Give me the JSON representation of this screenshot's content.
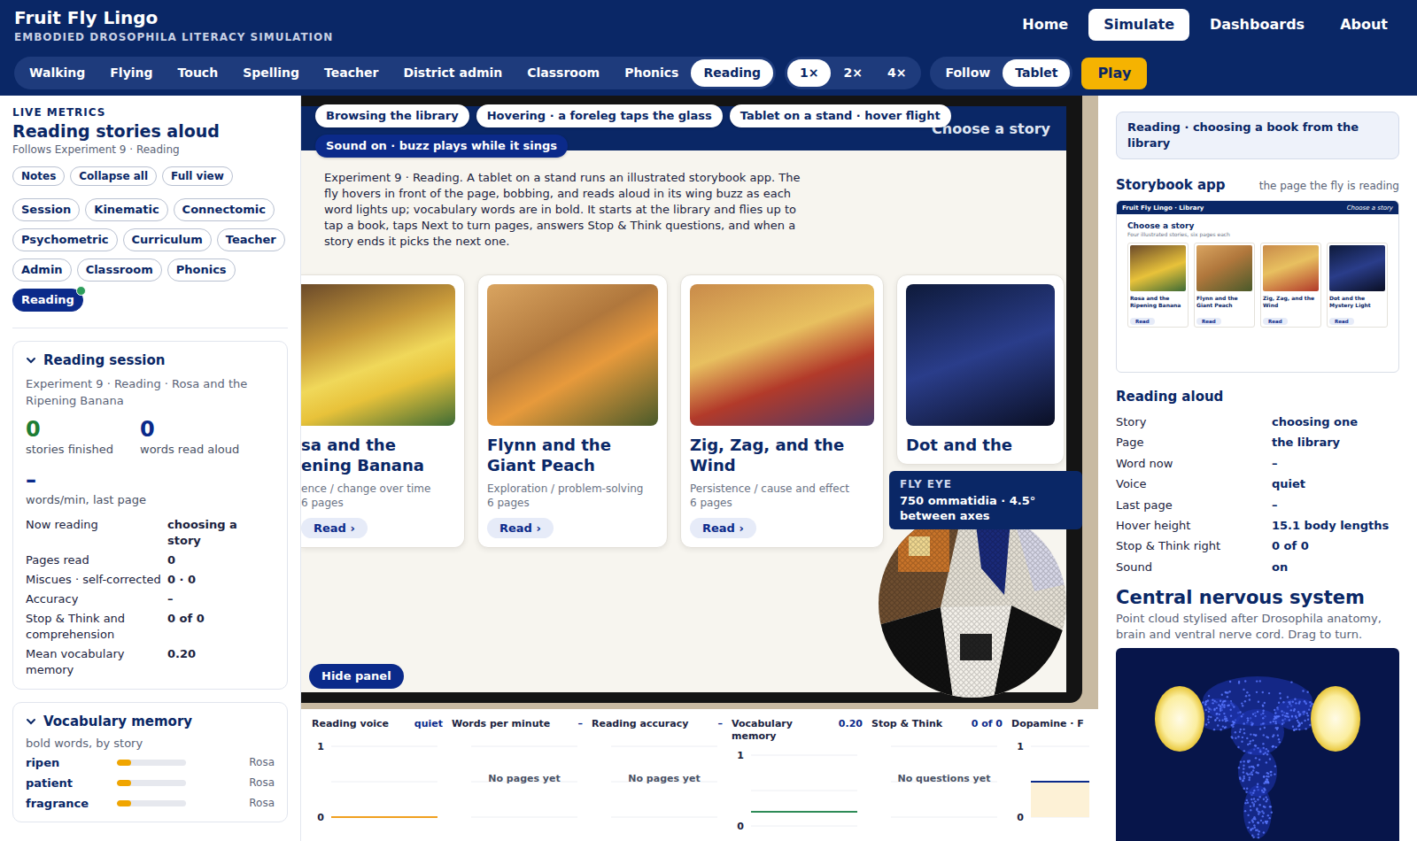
{
  "app": {
    "title": "Fruit Fly Lingo",
    "subtitle": "EMBODIED DROSOPHILA LITERACY SIMULATION"
  },
  "nav": [
    {
      "label": "Home",
      "selected": false
    },
    {
      "label": "Simulate",
      "selected": true
    },
    {
      "label": "Dashboards",
      "selected": false
    },
    {
      "label": "About",
      "selected": false
    }
  ],
  "modes": [
    {
      "label": "Walking",
      "selected": false
    },
    {
      "label": "Flying",
      "selected": false
    },
    {
      "label": "Touch",
      "selected": false
    },
    {
      "label": "Spelling",
      "selected": false
    },
    {
      "label": "Teacher",
      "selected": false
    },
    {
      "label": "District admin",
      "selected": false
    },
    {
      "label": "Classroom",
      "selected": false
    },
    {
      "label": "Phonics",
      "selected": false
    },
    {
      "label": "Reading",
      "selected": true
    }
  ],
  "speeds": [
    {
      "label": "1×",
      "selected": true
    },
    {
      "label": "2×",
      "selected": false
    },
    {
      "label": "4×",
      "selected": false
    }
  ],
  "camera": [
    {
      "label": "Follow",
      "selected": false
    },
    {
      "label": "Tablet",
      "selected": true
    }
  ],
  "play_button": "Play",
  "metrics_panel": {
    "eyebrow": "LIVE METRICS",
    "title": "Reading stories aloud",
    "subtitle": "Follows Experiment 9 · Reading",
    "actions": [
      "Notes",
      "Collapse all",
      "Full view"
    ],
    "filters": [
      {
        "label": "Session",
        "selected": false
      },
      {
        "label": "Kinematic",
        "selected": false
      },
      {
        "label": "Connectomic",
        "selected": false
      },
      {
        "label": "Psychometric",
        "selected": false
      },
      {
        "label": "Curriculum",
        "selected": false
      },
      {
        "label": "Teacher",
        "selected": false
      },
      {
        "label": "Admin",
        "selected": false
      },
      {
        "label": "Classroom",
        "selected": false
      },
      {
        "label": "Phonics",
        "selected": false
      },
      {
        "label": "Reading",
        "selected": true
      }
    ],
    "session_card": {
      "title": "Reading session",
      "expanded": true,
      "context": "Experiment 9 · Reading · Rosa and the Ripening Banana",
      "stats": [
        {
          "value": "0",
          "label": "stories finished",
          "color": "#1e7e34"
        },
        {
          "value": "0",
          "label": "words read aloud",
          "color": "#0b2a8a"
        }
      ],
      "wpm": {
        "value": "–",
        "label": "words/min, last page"
      },
      "rows": [
        {
          "label": "Now reading",
          "value": "choosing a story"
        },
        {
          "label": "Pages read",
          "value": "0"
        },
        {
          "label": "Miscues · self-corrected",
          "value": "0 · 0"
        },
        {
          "label": "Accuracy",
          "value": "–"
        },
        {
          "label": "Stop & Think and comprehension",
          "value": "0 of 0"
        },
        {
          "label": "Mean vocabulary memory",
          "value": "0.20"
        }
      ]
    },
    "vocab_card": {
      "title": "Vocabulary memory",
      "expanded": true,
      "subtitle": "bold words, by story",
      "words": [
        {
          "word": "ripen",
          "level": 0.2,
          "story": "Rosa"
        },
        {
          "word": "patient",
          "level": 0.2,
          "story": "Rosa"
        },
        {
          "word": "fragrance",
          "level": 0.2,
          "story": "Rosa"
        }
      ]
    }
  },
  "scene": {
    "chips": [
      {
        "label": "Browsing the library",
        "kind": "plain"
      },
      {
        "label": "Hovering · a foreleg taps the glass",
        "kind": "plain"
      },
      {
        "label": "Tablet on a stand · hover flight",
        "kind": "plain"
      },
      {
        "label": "Sound on · buzz plays while it sings",
        "kind": "accent"
      }
    ],
    "description": "Experiment 9 · Reading. A tablet on a stand runs an illustrated storybook app. The fly hovers in front of the page, bobbing, and reads aloud in its wing buzz as each word lights up; vocabulary words are in bold. It starts at the library and flies up to tap a book, taps Next to turn pages, answers Stop & Think questions, and when a story ends it picks the next one.",
    "tablet": {
      "header": "Choose a story",
      "cards": [
        {
          "title_lines": [
            "sa and the",
            "ening Banana"
          ],
          "tag": "ence / change over time",
          "meta": "6 pages",
          "button": "Read ›"
        },
        {
          "title_lines": [
            "Flynn and the",
            "Giant Peach"
          ],
          "tag": "Exploration / problem-solving",
          "meta": "6 pages",
          "button": "Read ›"
        },
        {
          "title_lines": [
            "Zig, Zag, and the",
            "Wind"
          ],
          "tag": "Persistence / cause and effect",
          "meta": "6 pages",
          "button": "Read ›"
        },
        {
          "title_lines": [
            "Dot and the"
          ]
        }
      ]
    },
    "hide_button": "Hide panel",
    "eye_tooltip": {
      "title": "FLY EYE",
      "text": "750 ommatidia · 4.5° between axes"
    }
  },
  "charts": [
    {
      "title": "Reading voice",
      "value": "quiet",
      "kind": "line",
      "ticks": [
        "1",
        "0"
      ],
      "series": [
        {
          "values": [
            0,
            0
          ],
          "color": "#f0a020"
        }
      ]
    },
    {
      "title": "Words per minute",
      "value": "–",
      "kind": "empty",
      "message": "No pages yet"
    },
    {
      "title": "Reading accuracy",
      "value": "–",
      "kind": "empty",
      "message": "No pages yet"
    },
    {
      "title": "Vocabulary memory",
      "value": "0.20",
      "kind": "line",
      "ticks": [
        "1",
        "0"
      ],
      "series": [
        {
          "values": [
            0.2,
            0.2
          ],
          "color": "#2e8b57"
        }
      ]
    },
    {
      "title": "Stop & Think",
      "value": "0 of 0",
      "kind": "empty",
      "message": "No questions yet"
    },
    {
      "title": "Dopamine · F",
      "kind": "area",
      "ticks": [
        "1",
        "0"
      ],
      "series": [
        {
          "values": [
            0.5,
            0.5
          ],
          "color": "#0b2a8a",
          "fill": "#fdf1d6"
        }
      ]
    }
  ],
  "info_panel": {
    "status": "Reading · choosing a book from the library",
    "storybook": {
      "title": "Storybook app",
      "note": "the page the fly is reading",
      "app_title": "Fruit Fly Lingo · Library",
      "header_right": "Choose a story",
      "heading": "Choose a story",
      "subtitle": "Four illustrated stories, six pages each",
      "cards": [
        {
          "title": "Rosa and the Ripening Banana",
          "button": "Read"
        },
        {
          "title": "Flynn and the Giant Peach",
          "button": "Read"
        },
        {
          "title": "Zig, Zag, and the Wind",
          "button": "Read"
        },
        {
          "title": "Dot and the Mystery Light",
          "button": "Read"
        }
      ]
    },
    "reading_title": "Reading aloud",
    "rows": [
      {
        "label": "Story",
        "value": "choosing one"
      },
      {
        "label": "Page",
        "value": "the library"
      },
      {
        "label": "Word now",
        "value": "–"
      },
      {
        "label": "Voice",
        "value": "quiet"
      },
      {
        "label": "Last page",
        "value": "–"
      },
      {
        "label": "Hover height",
        "value": "15.1 body lengths"
      },
      {
        "label": "Stop & Think right",
        "value": "0 of 0"
      },
      {
        "label": "Sound",
        "value": "on"
      }
    ],
    "cns_title": "Central nervous system",
    "cns_text": "Point cloud stylised after Drosophila anatomy, brain and ventral nerve cord. Drag to turn."
  }
}
